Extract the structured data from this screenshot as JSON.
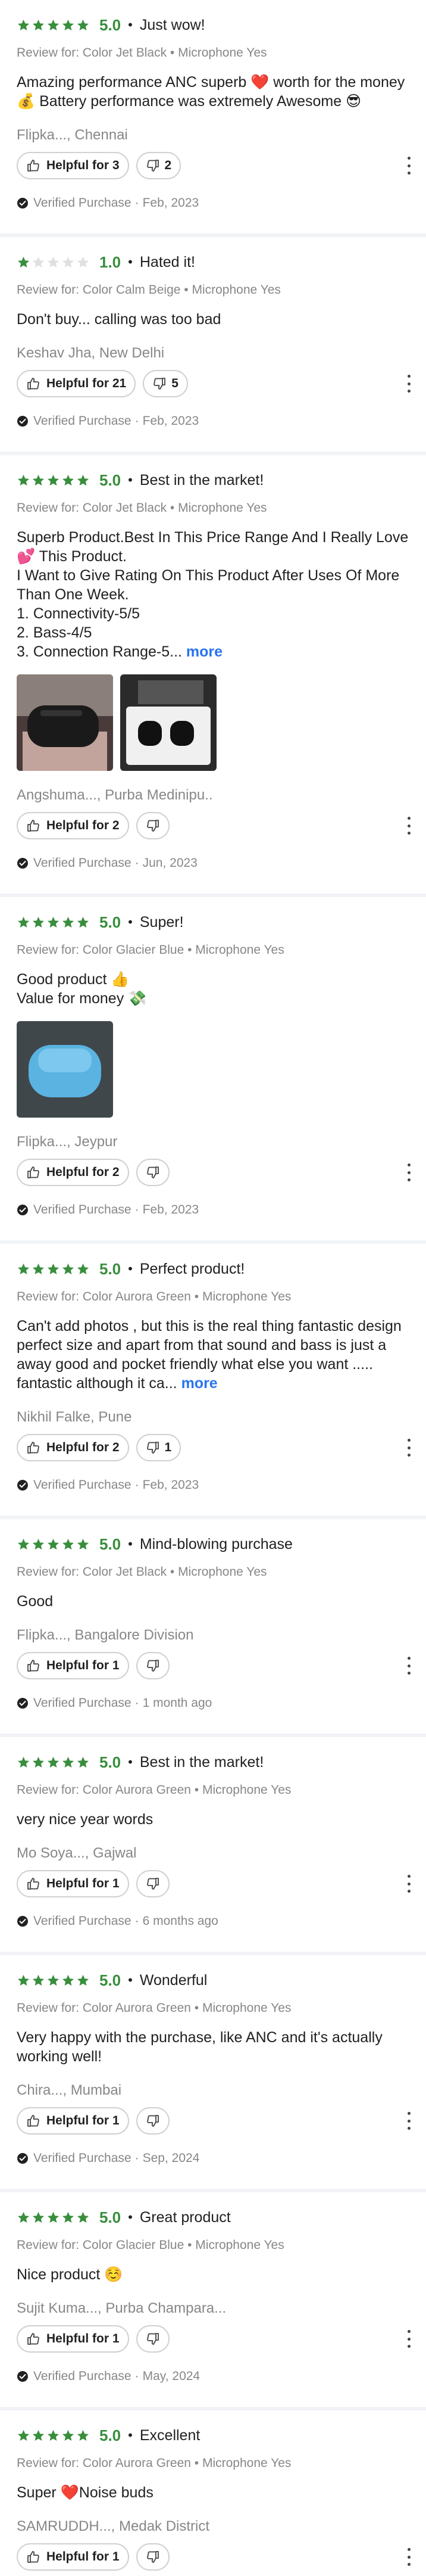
{
  "colors": {
    "star_filled": "#388e3c",
    "star_empty": "#e0e0e0",
    "link": "#2874f0",
    "muted": "#878787"
  },
  "verified_label": "Verified Purchase",
  "helpful_prefix": "Helpful for",
  "more_label": "more",
  "reviews": [
    {
      "stars": 5,
      "rating": "5.0",
      "title": "Just wow!",
      "meta": "Review for: Color Jet Black • Microphone Yes",
      "body": "Amazing performance ANC superb ❤️ worth for the money 💰 Battery performance was extremely Awesome 😎",
      "author": "Flipka..., Chennai",
      "helpful": "Helpful for 3",
      "dislikes": "2",
      "date": "Feb, 2023"
    },
    {
      "stars": 1,
      "rating": "1.0",
      "title": "Hated it!",
      "meta": "Review for: Color Calm Beige • Microphone Yes",
      "body": "Don't buy... calling was too bad",
      "author": "Keshav Jha, New Delhi",
      "helpful": "Helpful for 21",
      "dislikes": "5",
      "date": "Feb, 2023"
    },
    {
      "stars": 5,
      "rating": "5.0",
      "title": "Best in the market!",
      "meta": "Review for: Color Jet Black • Microphone Yes",
      "body": "Superb Product.Best In This Price Range And I Really Love 💕 This Product.\nI Want to Give Rating On This Product After Uses Of More Than One Week.\n1. Connectivity-5/5\n2. Bass-4/5\n3. Connection Range-5...",
      "author": "Angshuma..., Purba Medinipu..",
      "helpful": "Helpful for 2",
      "dislikes": "",
      "date": "Jun, 2023"
    },
    {
      "stars": 5,
      "rating": "5.0",
      "title": "Super!",
      "meta": "Review for: Color Glacier Blue • Microphone Yes",
      "body": "Good product 👍\nValue for money 💸",
      "author": "Flipka..., Jeypur",
      "helpful": "Helpful for 2",
      "dislikes": "",
      "date": "Feb, 2023"
    },
    {
      "stars": 5,
      "rating": "5.0",
      "title": "Perfect product!",
      "meta": "Review for: Color Aurora Green • Microphone Yes",
      "body": "Can't add photos , but this is the real thing fantastic design perfect size and apart from that sound and bass is just a away good and pocket friendly what else you want ..... fantastic although it ca...",
      "author": "Nikhil Falke, Pune",
      "helpful": "Helpful for 2",
      "dislikes": "1",
      "date": "Feb, 2023"
    },
    {
      "stars": 5,
      "rating": "5.0",
      "title": "Mind-blowing purchase",
      "meta": "Review for: Color Jet Black • Microphone Yes",
      "body": "Good",
      "author": "Flipka..., Bangalore Division",
      "helpful": "Helpful for 1",
      "dislikes": "",
      "date": "1 month ago"
    },
    {
      "stars": 5,
      "rating": "5.0",
      "title": "Best in the market!",
      "meta": "Review for: Color Aurora Green • Microphone Yes",
      "body": "very nice year words",
      "author": "Mo Soya..., Gajwal",
      "helpful": "Helpful for 1",
      "dislikes": "",
      "date": "6 months ago"
    },
    {
      "stars": 5,
      "rating": "5.0",
      "title": "Wonderful",
      "meta": "Review for: Color Aurora Green • Microphone Yes",
      "body": "Very happy with the purchase, like ANC and it's actually working well!",
      "author": "Chira..., Mumbai",
      "helpful": "Helpful for 1",
      "dislikes": "",
      "date": "Sep, 2024"
    },
    {
      "stars": 5,
      "rating": "5.0",
      "title": "Great product",
      "meta": "Review for: Color Glacier Blue • Microphone Yes",
      "body": "Nice product ☺️",
      "author": "Sujit Kuma..., Purba Champara...",
      "helpful": "Helpful for 1",
      "dislikes": "",
      "date": "May, 2024"
    },
    {
      "stars": 5,
      "rating": "5.0",
      "title": "Excellent",
      "meta": "Review for: Color Aurora Green • Microphone Yes",
      "body": "Super ❤️Noise buds",
      "author": "SAMRUDDH..., Medak District",
      "helpful": "Helpful for 1",
      "dislikes": "",
      "date": ""
    }
  ]
}
